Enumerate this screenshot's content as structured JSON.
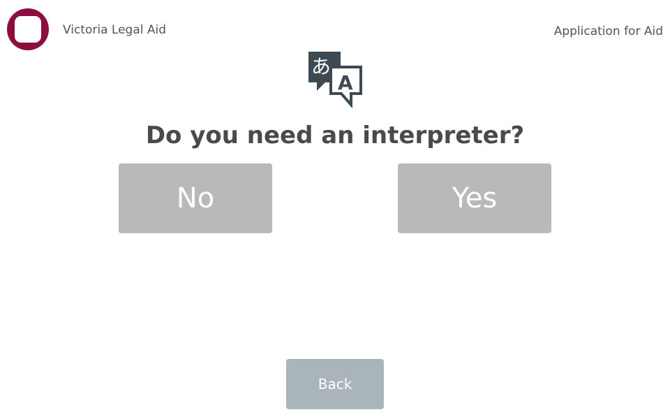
{
  "header": {
    "org_name": "Victoria Legal Aid",
    "app_title": "Application for Aid",
    "logo_color": "#8f0c3f"
  },
  "icon": {
    "name": "translate-icon",
    "glyph_left": "あ",
    "glyph_right": "A",
    "color": "#3d4a52"
  },
  "main": {
    "question": "Do you need an interpreter?",
    "no_label": "No",
    "yes_label": "Yes",
    "button_color": "#b9b9b9"
  },
  "footer": {
    "back_label": "Back",
    "back_color": "#a9b4bb"
  }
}
